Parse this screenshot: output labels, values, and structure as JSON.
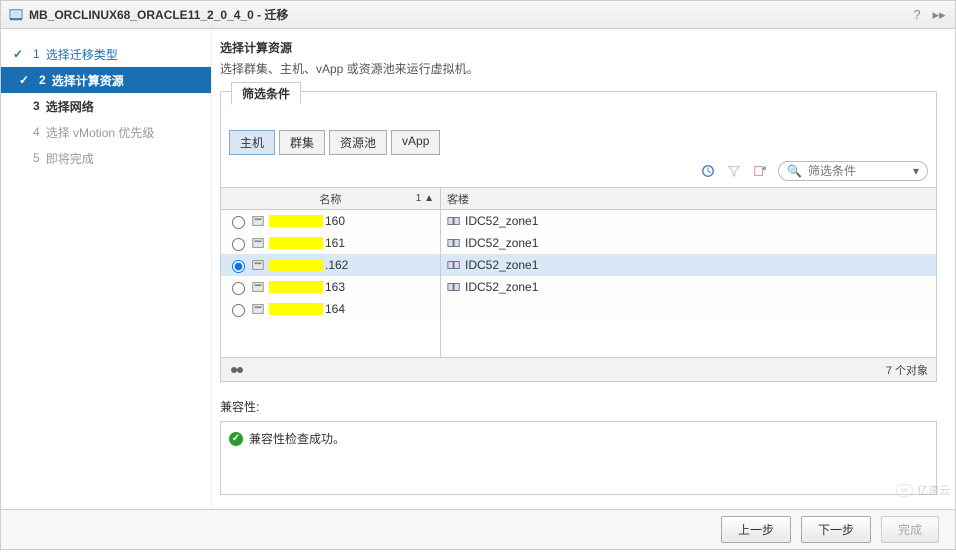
{
  "title": "MB_ORCLINUX68_ORACLE11_2_0_4_0 - 迁移",
  "steps": [
    {
      "num": "1",
      "label": "选择迁移类型",
      "state": "done"
    },
    {
      "num": "2",
      "label": "选择计算资源",
      "state": "active"
    },
    {
      "num": "3",
      "label": "选择网络",
      "state": "pending"
    },
    {
      "num": "4",
      "label": "选择 vMotion 优先级",
      "state": "disabled"
    },
    {
      "num": "5",
      "label": "即将完成",
      "state": "disabled"
    }
  ],
  "main": {
    "title": "选择计算资源",
    "subtitle": "选择群集、主机、vApp 或资源池来运行虚拟机。",
    "filter_tab": "筛选条件",
    "subtabs": [
      "主机",
      "群集",
      "资源池",
      "vApp"
    ],
    "active_subtab": 0,
    "search": {
      "placeholder": "筛选条件"
    },
    "columns": {
      "name": "名称",
      "sort": "1 ▲",
      "cluster": "客楼"
    },
    "rows": [
      {
        "suffix": "160",
        "cluster": "IDC52_zone1",
        "selected": false
      },
      {
        "suffix": "161",
        "cluster": "IDC52_zone1",
        "selected": false
      },
      {
        "suffix": ".162",
        "cluster": "IDC52_zone1",
        "selected": true
      },
      {
        "suffix": "163",
        "cluster": "IDC52_zone1",
        "selected": false
      },
      {
        "suffix": "164",
        "cluster": "",
        "selected": false
      }
    ],
    "object_count": "7 个对象",
    "compat_label": "兼容性:",
    "compat_msg": "兼容性检查成功。"
  },
  "footer": {
    "back": "上一步",
    "next": "下一步",
    "finish": "完成"
  },
  "watermark": "亿速云"
}
